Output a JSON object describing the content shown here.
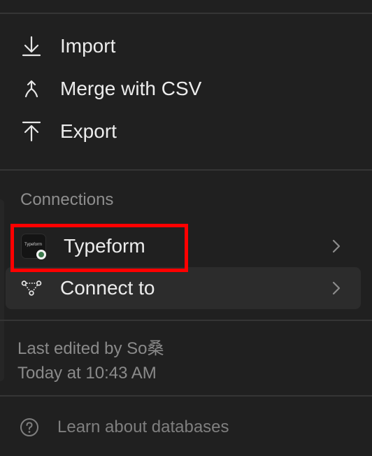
{
  "menu": {
    "items": [
      {
        "label": "Import",
        "icon": "arrow-down-to-line-icon"
      },
      {
        "label": "Merge with CSV",
        "icon": "merge-icon"
      },
      {
        "label": "Export",
        "icon": "arrow-up-from-line-icon"
      }
    ]
  },
  "connections": {
    "title": "Connections",
    "items": [
      {
        "label": "Typeform",
        "icon": "typeform-logo",
        "logo_text": "Typeform",
        "status_color": "#3c7a4c"
      },
      {
        "label": "Connect to",
        "icon": "connection-nodes-icon"
      }
    ]
  },
  "meta": {
    "edited_by": "Last edited by So桑",
    "edited_at": "Today at 10:43 AM"
  },
  "footer": {
    "learn_label": "Learn about databases",
    "icon": "question-circle-icon"
  },
  "colors": {
    "background": "#202020",
    "hover": "#2c2c2c",
    "highlight": "#ff0000",
    "status_green": "#3c7a4c"
  }
}
